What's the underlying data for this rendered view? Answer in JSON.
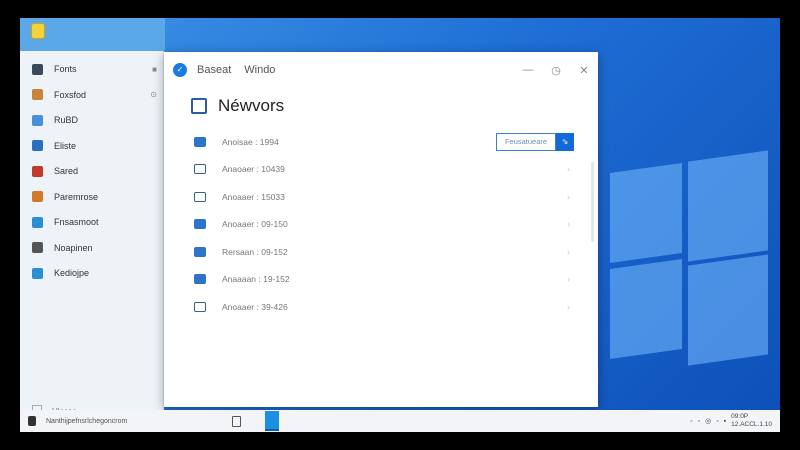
{
  "sidebar": {
    "items": [
      {
        "label": "Fonts",
        "color": "#3a4a5a",
        "trail": "■"
      },
      {
        "label": "Foxsfod",
        "color": "#c8843a",
        "trail": "⊙"
      },
      {
        "label": "RuBD",
        "color": "#4a90d9",
        "trail": ""
      },
      {
        "label": "Eliste",
        "color": "#2a6fc0",
        "trail": ""
      },
      {
        "label": "Sared",
        "color": "#c0392b",
        "trail": ""
      },
      {
        "label": "Paremrose",
        "color": "#d07a2a",
        "trail": ""
      },
      {
        "label": "Fnsasmoot",
        "color": "#2a8fd0",
        "trail": ""
      },
      {
        "label": "Noapinen",
        "color": "#555555",
        "trail": ""
      },
      {
        "label": "Kediojpe",
        "color": "#2a8fd0",
        "trail": ""
      }
    ],
    "footer": "Ulacas"
  },
  "window": {
    "title_1": "Baseat",
    "title_2": "Windo",
    "minimize": "—",
    "pin": "◷",
    "close": "✕",
    "heading": "Néwvors",
    "connect_label": "Feusatueare",
    "connect_icon": "⇘",
    "rows": [
      {
        "label": "Anoisae : 1994",
        "filled": true
      },
      {
        "label": "Anaoaer : 10439",
        "filled": false
      },
      {
        "label": "Anoaaer : 15033",
        "filled": false
      },
      {
        "label": "Anoaaer : 09-150",
        "filled": true
      },
      {
        "label": "Rersaan : 09-152",
        "filled": true
      },
      {
        "label": "Anaaaan : 19-152",
        "filled": true
      },
      {
        "label": "Anoaaer : 39-426",
        "filled": false
      }
    ]
  },
  "taskbar": {
    "search_text": "Nanthijpefnsrlchegoncrom",
    "clock_time": "09:0P",
    "clock_date": "12.ACCL.1.10",
    "tray_icons": [
      "wifi",
      "volume",
      "battery",
      "shield",
      "network"
    ]
  }
}
